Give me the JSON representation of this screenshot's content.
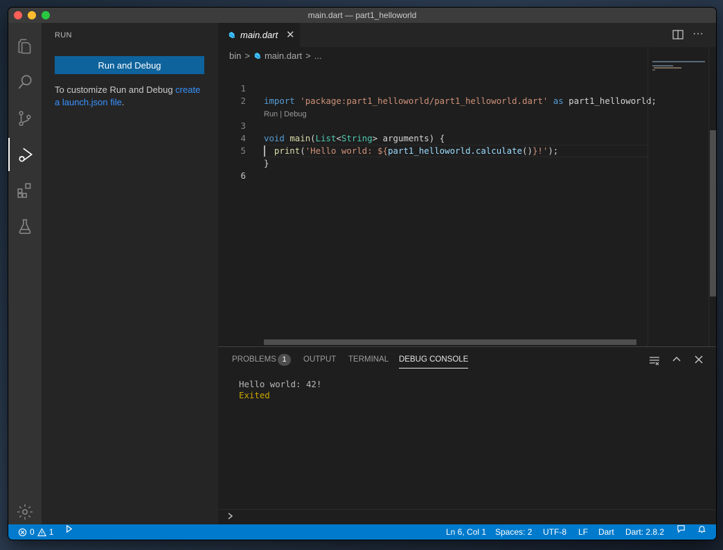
{
  "window": {
    "title": "main.dart — part1_helloworld"
  },
  "activity_bar": {
    "items": [
      "explorer-icon",
      "search-icon",
      "source-control-icon",
      "run-debug-icon",
      "extensions-icon",
      "testing-icon"
    ],
    "manage": "gear-icon"
  },
  "sidebar": {
    "title": "RUN",
    "run_button": "Run and Debug",
    "info_prefix": "To customize Run and Debug ",
    "info_link": "create a launch.json file",
    "info_suffix": "."
  },
  "editor": {
    "tab": {
      "label": "main.dart",
      "close": "✕"
    },
    "more": "···",
    "breadcrumb": {
      "folder": "bin",
      "sep1": ">",
      "file": "main.dart",
      "sep2": ">",
      "rest": "..."
    },
    "codelens": "Run | Debug",
    "lines": [
      {
        "num": "1"
      },
      {
        "num": "2"
      },
      {
        "num": "3"
      },
      {
        "num": "4"
      },
      {
        "num": "5"
      },
      {
        "num": "6"
      }
    ],
    "code": {
      "l1_import": "import",
      "l1_str": "'package:part1_helloworld/part1_helloworld.dart'",
      "l1_as": "as",
      "l1_alias": "part1_helloworld;",
      "l3_void": "void",
      "l3_main": "main",
      "l3_open": "(",
      "l3_list": "List",
      "l3_lt": "<",
      "l3_string": "String",
      "l3_gt": ">",
      "l3_args": " arguments) {",
      "l4_print": "print",
      "l4_open": "(",
      "l4_str1": "'Hello world: ${",
      "l4_call": "part1_helloworld.calculate",
      "l4_parens": "()",
      "l4_str2": "}!'",
      "l4_close": ");",
      "l5": "}"
    }
  },
  "panel": {
    "tabs": [
      {
        "label": "PROBLEMS"
      },
      {
        "label": "OUTPUT"
      },
      {
        "label": "TERMINAL"
      },
      {
        "label": "DEBUG CONSOLE"
      }
    ],
    "problems_count": "1",
    "console": {
      "line1": "Hello world: 42!",
      "line2": "Exited"
    }
  },
  "statusbar": {
    "errors": "0",
    "warnings": "1",
    "position": "Ln 6, Col 1",
    "spaces": "Spaces: 2",
    "encoding": "UTF-8",
    "eol": "LF",
    "language": "Dart",
    "sdk": "Dart: 2.8.2"
  },
  "colors": {
    "accent": "#007acc",
    "button": "#0e639c",
    "link": "#3794ff",
    "exited": "#cca700"
  }
}
